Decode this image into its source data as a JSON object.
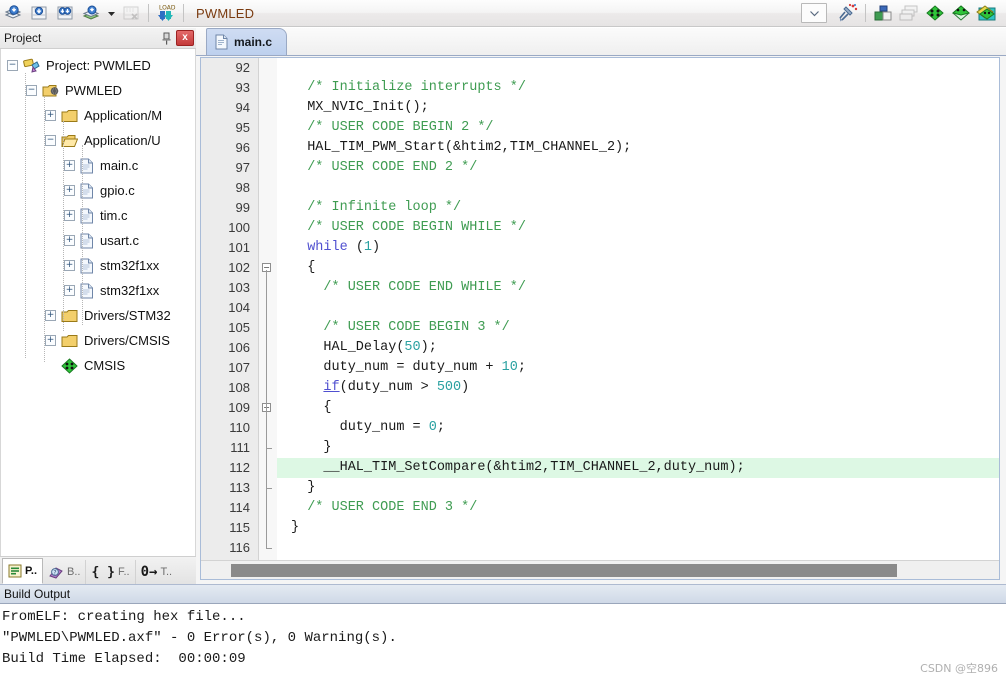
{
  "toolbar": {
    "buttons": [
      {
        "name": "translate-icon",
        "tip": "Translate"
      },
      {
        "name": "build-icon",
        "tip": "Build"
      },
      {
        "name": "rebuild-all-icon",
        "tip": "Rebuild"
      },
      {
        "name": "batch-build-icon",
        "tip": "Batch Build"
      },
      {
        "name": "batch-build-dropdown-icon",
        "tip": "Batch Build Options"
      },
      {
        "name": "stop-build-icon",
        "tip": "Stop Build"
      },
      {
        "name": "load-icon",
        "tip": "Download"
      }
    ],
    "project_name": "PWMLED",
    "target_dropdown_value": "",
    "right_buttons": [
      {
        "name": "target-options-icon",
        "tip": "Options for Target"
      },
      {
        "name": "manage-project-items-icon",
        "tip": "Manage Project Items"
      },
      {
        "name": "multi-project-icon",
        "tip": "Manage Multi-Project"
      },
      {
        "name": "pack-installer-icon",
        "tip": "Pack Installer"
      },
      {
        "name": "rte-manage-icon",
        "tip": "Manage Run-Time Environment"
      },
      {
        "name": "svcs-icon",
        "tip": "Software Packs"
      }
    ]
  },
  "project_panel": {
    "title": "Project",
    "pin_label": "⚓",
    "close_label": "x",
    "tree": [
      {
        "label": "Project: PWMLED",
        "indent": 0,
        "expander": "−",
        "icon": "project-icon"
      },
      {
        "label": "PWMLED",
        "indent": 1,
        "expander": "−",
        "icon": "target-icon"
      },
      {
        "label": "Application/M",
        "indent": 2,
        "expander": "+",
        "icon": "folder-closed-icon"
      },
      {
        "label": "Application/U",
        "indent": 2,
        "expander": "−",
        "icon": "folder-open-icon"
      },
      {
        "label": "main.c",
        "indent": 3,
        "expander": "+",
        "icon": "c-file-icon"
      },
      {
        "label": "gpio.c",
        "indent": 3,
        "expander": "+",
        "icon": "c-file-icon"
      },
      {
        "label": "tim.c",
        "indent": 3,
        "expander": "+",
        "icon": "c-file-icon"
      },
      {
        "label": "usart.c",
        "indent": 3,
        "expander": "+",
        "icon": "c-file-icon"
      },
      {
        "label": "stm32f1xx",
        "indent": 3,
        "expander": "+",
        "icon": "c-file-icon"
      },
      {
        "label": "stm32f1xx",
        "indent": 3,
        "expander": "+",
        "icon": "c-file-icon"
      },
      {
        "label": "Drivers/STM32",
        "indent": 2,
        "expander": "+",
        "icon": "folder-closed-icon"
      },
      {
        "label": "Drivers/CMSIS",
        "indent": 2,
        "expander": "+",
        "icon": "folder-closed-icon"
      },
      {
        "label": "CMSIS",
        "indent": 2,
        "expander": "",
        "icon": "cmsis-icon"
      }
    ],
    "scroll_left_arrow": "◀",
    "scroll_right_arrow": "▶",
    "tabs": [
      {
        "label": "P..",
        "icon": "project-tab-icon",
        "active": true
      },
      {
        "label": "B..",
        "icon": "books-tab-icon",
        "active": false
      },
      {
        "label": "F..",
        "icon": "functions-tab-icon",
        "active": false
      },
      {
        "label": "T..",
        "icon": "templates-tab-icon",
        "active": false
      }
    ]
  },
  "editor": {
    "tab_label": "main.c",
    "tab_icon": "c-file-icon",
    "first_line": 92,
    "lines": [
      {
        "n": 92,
        "fold": "",
        "html": ""
      },
      {
        "n": 93,
        "fold": "",
        "html": "  <span class='cmt'>/* Initialize interrupts */</span>"
      },
      {
        "n": 94,
        "fold": "",
        "html": "  MX_NVIC_Init();"
      },
      {
        "n": 95,
        "fold": "",
        "html": "  <span class='cmt'>/* USER CODE BEGIN 2 */</span>"
      },
      {
        "n": 96,
        "fold": "",
        "html": "  HAL_TIM_PWM_Start(&amp;htim2,TIM_CHANNEL_2);"
      },
      {
        "n": 97,
        "fold": "",
        "html": "  <span class='cmt'>/* USER CODE END 2 */</span>"
      },
      {
        "n": 98,
        "fold": "",
        "html": ""
      },
      {
        "n": 99,
        "fold": "",
        "html": "  <span class='cmt'>/* Infinite loop */</span>"
      },
      {
        "n": 100,
        "fold": "",
        "html": "  <span class='cmt'>/* USER CODE BEGIN WHILE */</span>"
      },
      {
        "n": 101,
        "fold": "",
        "html": "  <span class='kw'>while</span> (<span class='num'>1</span>)"
      },
      {
        "n": 102,
        "fold": "minus",
        "html": "  {"
      },
      {
        "n": 103,
        "fold": "",
        "html": "    <span class='cmt'>/* USER CODE END WHILE */</span>"
      },
      {
        "n": 104,
        "fold": "",
        "html": ""
      },
      {
        "n": 105,
        "fold": "",
        "html": "    <span class='cmt'>/* USER CODE BEGIN 3 */</span>"
      },
      {
        "n": 106,
        "fold": "",
        "html": "    HAL_Delay(<span class='num'>50</span>);"
      },
      {
        "n": 107,
        "fold": "",
        "html": "    duty_num = duty_num + <span class='num'>10</span>;"
      },
      {
        "n": 108,
        "fold": "",
        "html": "    <span class='kwu'>if</span>(duty_num &gt; <span class='num'>500</span>)"
      },
      {
        "n": 109,
        "fold": "minus",
        "html": "    {"
      },
      {
        "n": 110,
        "fold": "",
        "html": "      duty_num = <span class='num'>0</span>;"
      },
      {
        "n": 111,
        "fold": "tick",
        "html": "    }"
      },
      {
        "n": 112,
        "fold": "",
        "html": "    __HAL_TIM_SetCompare(&amp;htim2,TIM_CHANNEL_2,duty_num);",
        "highlight": true
      },
      {
        "n": 113,
        "fold": "tick",
        "html": "  }"
      },
      {
        "n": 114,
        "fold": "",
        "html": "  <span class='cmt'>/* USER CODE END 3 */</span>"
      },
      {
        "n": 115,
        "fold": "",
        "html": "}"
      },
      {
        "n": 116,
        "fold": "end",
        "html": ""
      }
    ]
  },
  "build_output": {
    "title": "Build Output",
    "lines": [
      "FromELF: creating hex file...",
      "\"PWMLED\\PWMLED.axf\" - 0 Error(s), 0 Warning(s).",
      "Build Time Elapsed:  00:00:09"
    ]
  },
  "watermark": "CSDN @空896",
  "colors": {
    "comment_green": "#3f9c52",
    "keyword_blue": "#5050d0",
    "number_teal": "#2aa1a1",
    "highlight_green": "#ddf8e4",
    "project_name_brown": "#7a3b10",
    "tab_blue": "#bdd0ee"
  }
}
